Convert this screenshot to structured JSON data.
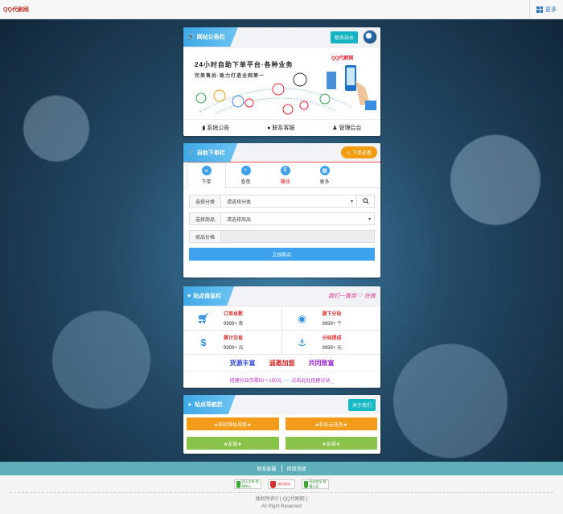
{
  "header": {
    "brand": "QQ代刷网",
    "more_label": "更多"
  },
  "notice": {
    "title": "网站公告栏",
    "contact_button": "联系站长",
    "banner_title": "24小时自助下单平台·各种业务",
    "banner_sub": "完美售后·致力打造全网第一",
    "banner_logo": "QQ代刷网",
    "links": [
      {
        "icon": "file-icon",
        "label": "系统公告"
      },
      {
        "icon": "qq-icon",
        "label": "联系客服"
      },
      {
        "icon": "user-icon",
        "label": "管理后台"
      }
    ]
  },
  "order": {
    "title": "自助下单栏",
    "notice_button": "下单必看",
    "tabs": [
      {
        "icon": "cart-icon",
        "label": "下单",
        "active": true
      },
      {
        "icon": "search-icon",
        "label": "查单",
        "active": false
      },
      {
        "icon": "dollar-icon",
        "label": "赚钱",
        "active": false
      },
      {
        "icon": "more-icon",
        "label": "更多",
        "active": false
      }
    ],
    "category_label": "选择分类",
    "category_value": "请选择分类",
    "product_label": "选择商品",
    "product_value": "请选择商品",
    "price_label": "商品价格",
    "price_value": "",
    "buy_button": "立即购买"
  },
  "stats": {
    "title": "站点信息栏",
    "slogan": "我们一直用 ♡ 在做",
    "items": [
      {
        "icon": "cart-icon",
        "title": "订单总数",
        "value": "9999+ 条"
      },
      {
        "icon": "fire-icon",
        "title": "旗下分站",
        "value": "9999+ 个"
      },
      {
        "icon": "dollar-icon",
        "title": "累计交易",
        "value": "9999+ 元"
      },
      {
        "icon": "anchor-icon",
        "title": "分站提成",
        "value": "9999+ 元"
      }
    ],
    "slogans": [
      {
        "text": "货源丰富",
        "color": "#3b4fd8"
      },
      {
        "text": "诚邀加盟",
        "color": "#d92a2a"
      },
      {
        "text": "共同致富",
        "color": "#9a2bd1"
      }
    ],
    "pitch_left": "搭建分站仅需50～150元",
    "pitch_sep": "—",
    "pitch_right": "点击此处搭建分站 _"
  },
  "nav": {
    "title": "站点导航栏",
    "about_button": "关于我们",
    "links": [
      {
        "label": "★彩虹网址导航★",
        "color": "orange"
      },
      {
        "label": "★彩虹云任务★",
        "color": "orange"
      },
      {
        "label": "★友链★",
        "color": "green"
      },
      {
        "label": "★友链★",
        "color": "green"
      }
    ]
  },
  "footer": {
    "links": [
      "联系客服",
      "回到顶部"
    ],
    "badges": [
      {
        "text": "网上交易 保障中心",
        "color": "green"
      },
      {
        "text": "诚信网站",
        "color": "red"
      },
      {
        "text": "网站安全 联盟认证",
        "color": "green"
      }
    ],
    "copyright": "版权所有© [ QQ代刷网 ]",
    "rights": "All Right Reserved"
  },
  "colors": {
    "accent": "#3fa9e6",
    "teal": "#13b3c1",
    "orange": "#f39c12",
    "green": "#8ac34a",
    "red": "#e02020"
  }
}
